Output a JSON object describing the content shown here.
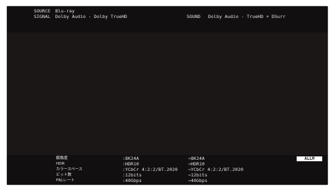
{
  "header": {
    "source_label": "SOURCE",
    "source_value": "Blu-ray",
    "signal_label": "SIGNAL",
    "signal_value": "Dolby Audio - Dolby TrueHD",
    "sound_label": "SOUND",
    "sound_value": "Dolby Audio - TrueHD + DSurr"
  },
  "video_info": {
    "rows": [
      {
        "label": "解像度",
        "input": ":8K24A",
        "output": "⇒8K24A"
      },
      {
        "label": "HDR",
        "input": ":HDR10",
        "output": "⇒HDR10"
      },
      {
        "label": "カラースペース",
        "input": ":YCbCr 4:2:2/BT.2020",
        "output": "⇒YCbCr 4:2:2/BT.2020"
      },
      {
        "label": "ビット数",
        "input": ":12bits",
        "output": "⇒12bits"
      },
      {
        "label": "FRLレート",
        "input": ":40Gbps",
        "output": "⇒40Gbps"
      }
    ],
    "allm_badge": "ALLM"
  }
}
